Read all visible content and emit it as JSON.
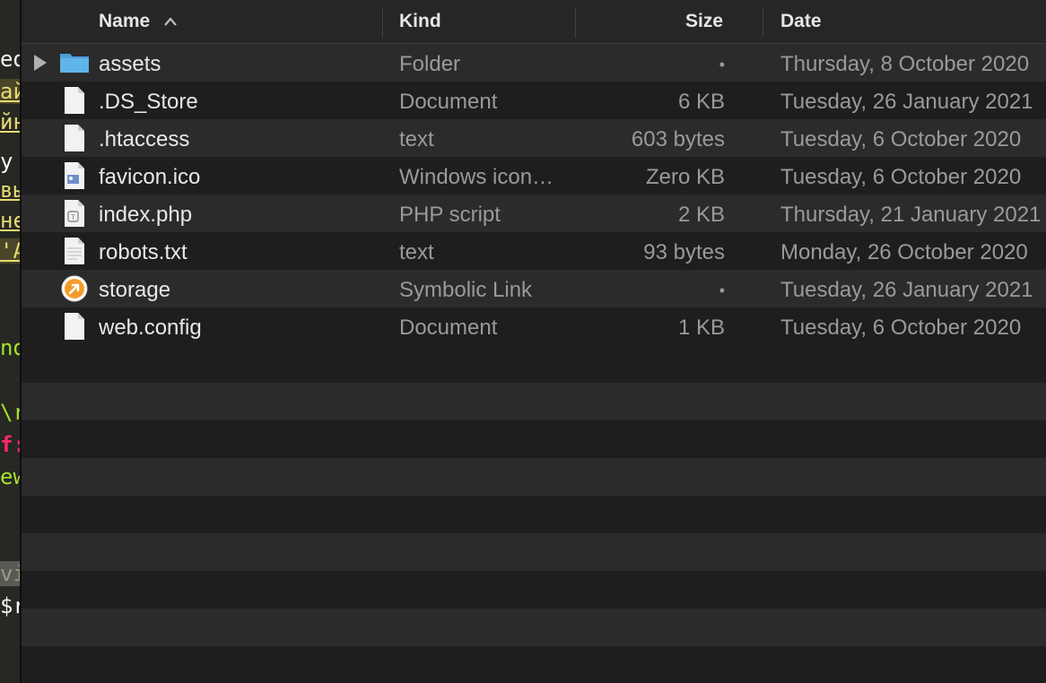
{
  "editor_fragments": [
    {
      "text": "ed",
      "color": "#f8f8f2"
    },
    {
      "text": "ай",
      "color": "#e6db74"
    },
    {
      "text": "йн",
      "color": "#e6db74"
    },
    {
      "text": "у",
      "color": "#f8f8f2"
    },
    {
      "text": "вы",
      "color": "#e6db74"
    },
    {
      "text": "не",
      "color": "#e6db74"
    },
    {
      "text": "'А",
      "color": "#e6db74"
    },
    {
      "text": "nd",
      "color": "#a6e22e"
    },
    {
      "text": "\\r",
      "color": "#a6e22e"
    },
    {
      "text": "f:",
      "color": "#f92672"
    },
    {
      "text": "ew",
      "color": "#a6e22e"
    },
    {
      "text": "vie",
      "color": "#75715e"
    },
    {
      "text": "$r",
      "color": "#f8f8f2"
    }
  ],
  "columns": {
    "name": "Name",
    "kind": "Kind",
    "size": "Size",
    "date": "Date",
    "sort_indicator": "^"
  },
  "files": [
    {
      "name": "assets",
      "kind": "Folder",
      "size": "•",
      "date": "Thursday, 8 October 2020",
      "icon": "folder-icon",
      "expandable": true
    },
    {
      "name": ".DS_Store",
      "kind": "Document",
      "size": "6 KB",
      "date": "Tuesday, 26 January 2021",
      "icon": "document-icon"
    },
    {
      "name": ".htaccess",
      "kind": "text",
      "size": "603 bytes",
      "date": "Tuesday, 6 October 2020",
      "icon": "document-icon"
    },
    {
      "name": "favicon.ico",
      "kind": "Windows icon…",
      "size": "Zero KB",
      "date": "Tuesday, 6 October 2020",
      "icon": "image-file-icon"
    },
    {
      "name": "index.php",
      "kind": "PHP script",
      "size": "2 KB",
      "date": "Thursday, 21 January 2021",
      "icon": "script-file-icon"
    },
    {
      "name": "robots.txt",
      "kind": "text",
      "size": "93 bytes",
      "date": "Monday, 26 October 2020",
      "icon": "text-file-icon"
    },
    {
      "name": "storage",
      "kind": "Symbolic Link",
      "size": "•",
      "date": "Tuesday, 26 January 2021",
      "icon": "symlink-icon"
    },
    {
      "name": "web.config",
      "kind": "Document",
      "size": "1 KB",
      "date": "Tuesday, 6 October 2020",
      "icon": "document-icon"
    }
  ],
  "colors": {
    "folder": "#5fb4e8",
    "symlink": "#f39c2a",
    "row_alt": "#2b2b2b",
    "background": "#1e1e1e"
  }
}
